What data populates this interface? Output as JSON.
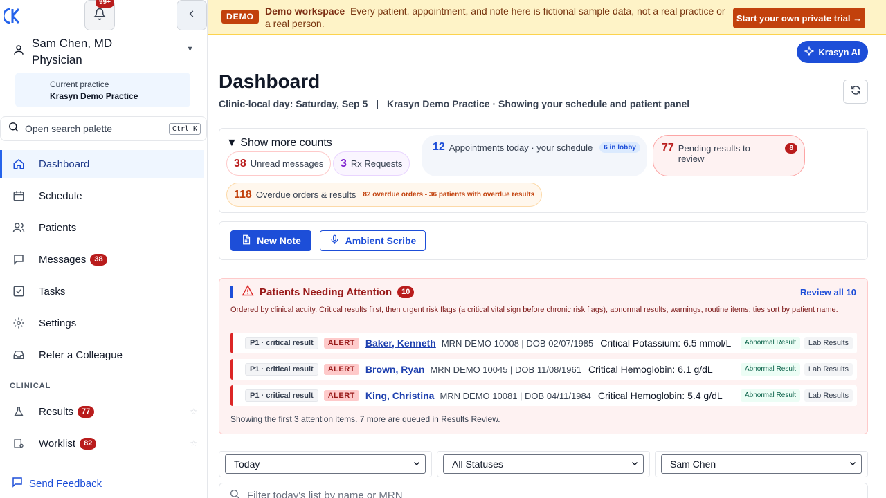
{
  "sidebar": {
    "logo_text": "K",
    "notifications_badge": "99+",
    "user": {
      "name": "Sam Chen, MD",
      "role": "Physician"
    },
    "practice": {
      "label": "Current practice",
      "name": "Krasyn Demo Practice"
    },
    "search": {
      "placeholder": "Open search palette",
      "shortcut": "Ctrl K"
    },
    "nav": [
      {
        "label": "Dashboard",
        "icon": "home-icon",
        "active": true
      },
      {
        "label": "Schedule",
        "icon": "calendar-icon"
      },
      {
        "label": "Patients",
        "icon": "users-icon"
      },
      {
        "label": "Messages",
        "icon": "message-icon",
        "badge": "38"
      },
      {
        "label": "Tasks",
        "icon": "checkbox-icon"
      },
      {
        "label": "Settings",
        "icon": "gear-icon"
      },
      {
        "label": "Refer a Colleague",
        "icon": "inbox-icon"
      }
    ],
    "section_clinical": "CLINICAL",
    "clinical": [
      {
        "label": "Results",
        "icon": "flask-icon",
        "badge": "77"
      },
      {
        "label": "Worklist",
        "icon": "worklist-icon",
        "badge": "82"
      }
    ],
    "feedback": "Send Feedback"
  },
  "banner": {
    "tag": "DEMO",
    "title": "Demo workspace",
    "text": "Every patient, appointment, and note here is fictional sample data, not a real practice or a real person.",
    "cta": "Start your own private trial →"
  },
  "ai_button": "Krasyn AI",
  "page": {
    "title": "Dashboard",
    "day": "Clinic-local day: Saturday, Sep 5",
    "context": "Krasyn Demo Practice · Showing your schedule and patient panel"
  },
  "counts": {
    "toggle": "Show more counts",
    "unread": {
      "num": "38",
      "label": "Unread messages"
    },
    "rx": {
      "num": "3",
      "label": "Rx Requests"
    },
    "appointments": {
      "num": "12",
      "label": "Appointments today · your schedule",
      "extra": "6 in lobby"
    },
    "pending": {
      "num": "77",
      "label": "Pending results to review",
      "extra": "8"
    },
    "overdue": {
      "num": "118",
      "label": "Overdue orders & results",
      "extra": "82 overdue orders - 36 patients with overdue results"
    }
  },
  "actions": {
    "new_note": "New Note",
    "scribe": "Ambient Scribe"
  },
  "attention": {
    "title": "Patients Needing Attention",
    "count": "10",
    "review_all": "Review all 10",
    "description": "Ordered by clinical acuity. Critical results first, then urgent risk flags (a critical vital sign before chronic risk flags), abnormal results, warnings, routine items; ties sort by patient name.",
    "rows": [
      {
        "priority": "P1 · critical result",
        "flag": "ALERT",
        "name": "Baker, Kenneth",
        "mrn": "MRN DEMO 10008 | DOB 02/07/1985",
        "result": "Critical Potassium: 6.5 mmol/L",
        "tag1": "Abnormal Result",
        "tag2": "Lab Results"
      },
      {
        "priority": "P1 · critical result",
        "flag": "ALERT",
        "name": "Brown, Ryan",
        "mrn": "MRN DEMO 10045 | DOB 11/08/1961",
        "result": "Critical Hemoglobin: 6.1 g/dL",
        "tag1": "Abnormal Result",
        "tag2": "Lab Results"
      },
      {
        "priority": "P1 · critical result",
        "flag": "ALERT",
        "name": "King, Christina",
        "mrn": "MRN DEMO 10081 | DOB 04/11/1984",
        "result": "Critical Hemoglobin: 5.4 g/dL",
        "tag1": "Abnormal Result",
        "tag2": "Lab Results"
      }
    ],
    "footer": "Showing the first 3 attention items. 7 more are queued in Results Review."
  },
  "filters": {
    "date": "Today",
    "status": "All Statuses",
    "provider": "Sam Chen",
    "search_placeholder": "Filter today's list by name or MRN"
  },
  "colors": {
    "primary": "#1d4ed8",
    "danger": "#b91c1c",
    "demo": "#c2410c",
    "banner_bg": "#fef3c7"
  }
}
